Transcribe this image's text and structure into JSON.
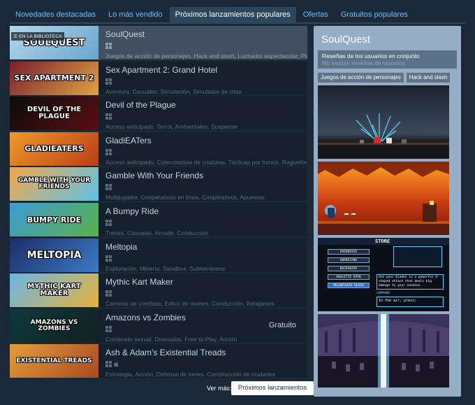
{
  "tabs": [
    {
      "label": "Novedades destacadas"
    },
    {
      "label": "Lo más vendido"
    },
    {
      "label": "Próximos lanzamientos populares",
      "active": true
    },
    {
      "label": "Ofertas"
    },
    {
      "label": "Gratuitos populares"
    }
  ],
  "games": [
    {
      "name": "SoulQuest",
      "badge": "☰ EN LA BIBLIOTECA",
      "capsule": "SOULQUEST",
      "platforms": [
        "windows"
      ],
      "tags": "Juegos de acción de personajes, Hack and slash, Luchador espectacular, Plataf",
      "price": "",
      "colors": [
        "#b3d6ea",
        "#6aa5cc"
      ]
    },
    {
      "name": "Sex Apartment 2: Grand Hotel",
      "capsule": "SEX APARTMENT 2",
      "platforms": [
        "windows"
      ],
      "tags": "Aventura, Casuales, Simulación, Simulador de citas",
      "price": "",
      "colors": [
        "#7a1e2e",
        "#e0a343"
      ]
    },
    {
      "name": "Devil of the Plague",
      "capsule": "DEVIL OF THE PLAGUE",
      "platforms": [
        "windows"
      ],
      "tags": "Acceso anticipado, Terror, Ambientales, Suspense",
      "price": "",
      "colors": [
        "#0b0b0b",
        "#5a0f12"
      ]
    },
    {
      "name": "GladiEATers",
      "capsule": "GLADIEATERS",
      "platforms": [
        "windows"
      ],
      "tags": "Acceso anticipado, Coleccionista de criaturas, Tácticas por turnos, Roguelite",
      "price": "",
      "colors": [
        "#f09a28",
        "#ba3d15"
      ]
    },
    {
      "name": "Gamble With Your Friends",
      "capsule": "GAMBLE WITH YOUR FRIENDS",
      "platforms": [
        "windows"
      ],
      "tags": "Multijugador, Cooperativos en línea, Cooperativos, Apuestas",
      "price": "",
      "colors": [
        "#f2a84a",
        "#5ec2e8"
      ]
    },
    {
      "name": "A Bumpy Ride",
      "capsule": "BUMPY RIDE",
      "platforms": [
        "windows"
      ],
      "tags": "Trenes, Casuales, Arcade, Conducción",
      "price": "",
      "colors": [
        "#3d9ad4",
        "#5ab14b"
      ]
    },
    {
      "name": "Meltopia",
      "capsule": "MELTOPIA",
      "platforms": [
        "windows"
      ],
      "tags": "Exploración, Minería, Sandbox, Subterráneos",
      "price": "",
      "colors": [
        "#1d2d67",
        "#3c7bc4"
      ]
    },
    {
      "name": "Mythic Kart Maker",
      "capsule": "MYTHIC KART MAKER",
      "platforms": [
        "windows"
      ],
      "tags": "Carreras de combate, Editor de niveles, Conducción, Relajantes",
      "price": "",
      "colors": [
        "#6ab6e6",
        "#e6b23a"
      ]
    },
    {
      "name": "Amazons vs Zombies",
      "capsule": "AMAZONS VS ZOMBIES",
      "platforms": [
        "windows"
      ],
      "tags": "Contenido sexual, Desnudos, Free to Play, Acción",
      "price": "Gratuito",
      "colors": [
        "#0d3a3d",
        "#14201f"
      ]
    },
    {
      "name": "Ash & Adam's Existential Treads",
      "capsule": "EXISTENTIAL TREADS",
      "platforms": [
        "windows",
        "apple"
      ],
      "tags": "Estrategia, Acción, Defensa de torres, Construcción de ciudades",
      "price": "",
      "colors": [
        "#e49f39",
        "#a84822"
      ]
    }
  ],
  "see_more": {
    "label": "Ver más:",
    "button": "Próximos lanzamientos"
  },
  "side": {
    "title": "SoulQuest",
    "review_title": "Reseñas de los usuarios en conjunto",
    "review_value": "No existen reseñas de usuarios",
    "tags": [
      "Juegos de acción de personajes",
      "Hack and slash"
    ],
    "store_label": "STORE",
    "store_items": [
      "OVERDRIVE",
      "HURRICANE",
      "BACKSWIPE",
      "ROULETTE SPIN",
      "RELENTLESS SLASH"
    ],
    "store_desc": "Use your blades in a powerful X-shaped attack that deals big damage to your enemies.",
    "store_command": "COMMAND",
    "store_air": "In the air, press:"
  }
}
